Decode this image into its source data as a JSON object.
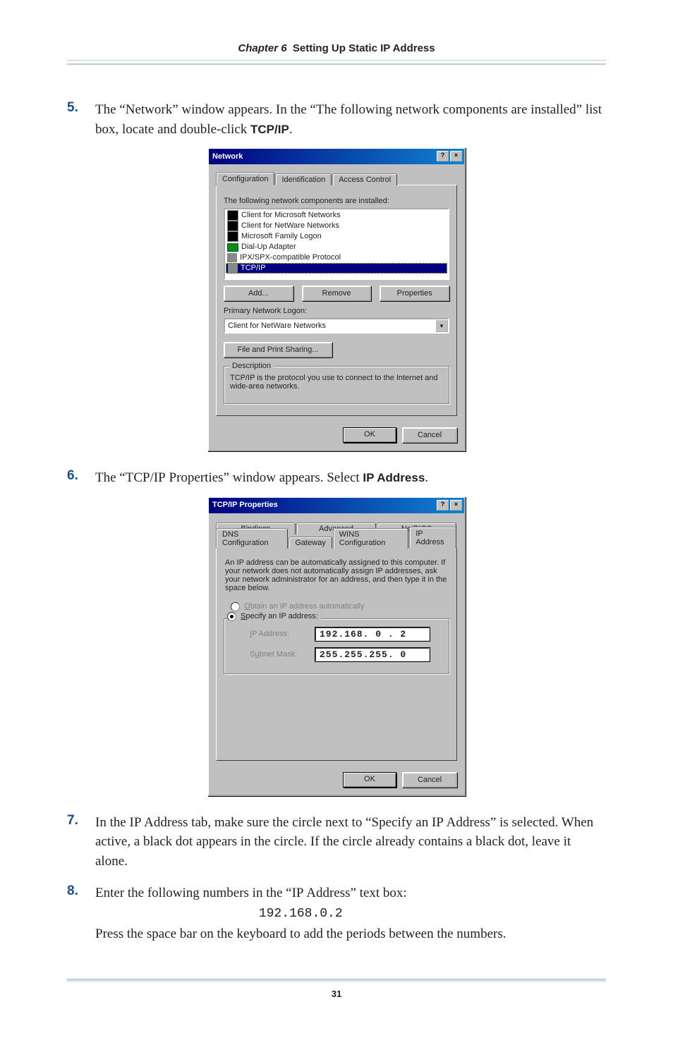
{
  "chapterLabel": "Chapter 6",
  "chapterTitle": "Setting Up Static IP Address",
  "step5": {
    "num": "5.",
    "textBefore": "The “Network” window appears. In the “The following network components are installed” list box, locate and double-click ",
    "boldTerm": "TCP/IP",
    "textAfter": "."
  },
  "networkDialog": {
    "title": "Network",
    "tabs": [
      "Configuration",
      "Identification",
      "Access Control"
    ],
    "activeTab": 0,
    "listLabel": "The following network components are installed:",
    "items": [
      "Client for Microsoft Networks",
      "Client for NetWare Networks",
      "Microsoft Family Logon",
      "Dial-Up Adapter",
      "IPX/SPX-compatible Protocol",
      "TCP/IP"
    ],
    "selectedIndex": 5,
    "btnAdd": "Add...",
    "btnRemove": "Remove",
    "btnProperties": "Properties",
    "primaryLogonLabel": "Primary Network Logon:",
    "primaryLogonValue": "Client for NetWare Networks",
    "fileShareBtn": "File and Print Sharing...",
    "descGroup": "Description",
    "descText": "TCP/IP is the protocol you use to connect to the Internet and wide-area networks.",
    "ok": "OK",
    "cancel": "Cancel"
  },
  "step6": {
    "num": "6.",
    "textBefore": "The “",
    "smallCaps1": "TCP/IP",
    "textMid": " Properties” window appears. Select ",
    "boldTerm": "IP Address",
    "textAfter": "."
  },
  "tcpipDialog": {
    "title": "TCP/IP Properties",
    "tabsRow1": [
      "Bindings",
      "Advanced",
      "NetBIOS"
    ],
    "tabsRow2": [
      "DNS Configuration",
      "Gateway",
      "WINS Configuration",
      "IP Address"
    ],
    "activeTabRow2": 3,
    "blurb": "An IP address can be automatically assigned to this computer. If your network does not automatically assign IP addresses, ask your network administrator for an address, and then type it in the space below.",
    "radioAuto": "Obtain an IP address automatically",
    "radioSpecify": "Specify an IP address:",
    "ipLabel": "IP Address:",
    "ipValue": "192.168. 0 . 2",
    "maskLabel": "Subnet Mask:",
    "maskValue": "255.255.255. 0",
    "ok": "OK",
    "cancel": "Cancel"
  },
  "step7": {
    "num": "7.",
    "t1": "In the ",
    "sc1": "IP",
    "t2": " Address tab, make sure the circle next to “Specify an ",
    "sc2": "IP",
    "t3": " Address” is selected. When active, a black dot appears in the circle. If the circle already contains a black dot, leave it alone."
  },
  "step8": {
    "num": "8.",
    "t1": "Enter the following numbers in the “",
    "sc1": "IP",
    "t2": " Address” text box:",
    "code": "192.168.0.2",
    "t3": "Press the space bar on the keyboard to add the periods between the numbers."
  },
  "pageNumber": "31"
}
